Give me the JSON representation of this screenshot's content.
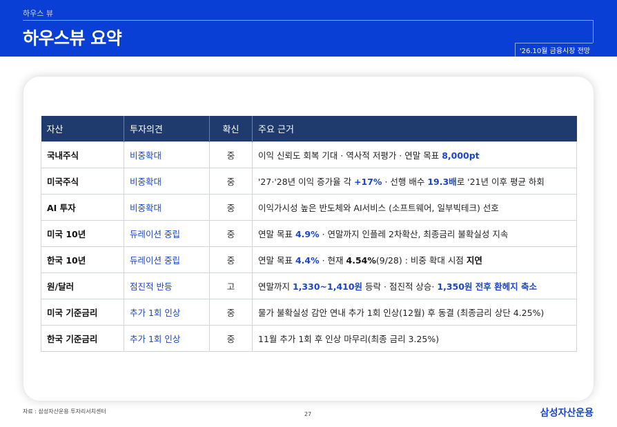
{
  "header": {
    "kicker": "하우스 뷰",
    "title": "하우스뷰 요약",
    "tag": "'26.10월 금융시장 전망"
  },
  "table": {
    "columns": [
      "자산",
      "투자의견",
      "확신",
      "주요 근거"
    ],
    "rows": [
      {
        "asset": "국내주식",
        "opinion": "비중확대",
        "confidence": "중",
        "rationale": [
          {
            "t": "이익 신뢰도 회복 기대 · 역사적 저평가 · 연말 목표 ",
            "s": "n"
          },
          {
            "t": "8,000pt",
            "s": "hl"
          }
        ]
      },
      {
        "asset": "미국주식",
        "opinion": "비중확대",
        "confidence": "중",
        "rationale": [
          {
            "t": "'27·'28년 이익 증가율 각 ",
            "s": "n"
          },
          {
            "t": "+17%",
            "s": "hl"
          },
          {
            "t": " · 선행 배수 ",
            "s": "n"
          },
          {
            "t": "19.3배",
            "s": "hl"
          },
          {
            "t": "로 '21년 이후 평균 하회",
            "s": "n"
          }
        ]
      },
      {
        "asset": "AI 투자",
        "opinion": "비중확대",
        "confidence": "중",
        "rationale": [
          {
            "t": "이익가시성 높은 반도체와 AI서비스 (소프트웨어, 일부빅테크) 선호",
            "s": "n"
          }
        ]
      },
      {
        "asset": "미국 10년",
        "opinion": "듀레이션 중립",
        "confidence": "중",
        "rationale": [
          {
            "t": "연말 목표 ",
            "s": "n"
          },
          {
            "t": "4.9%",
            "s": "hl"
          },
          {
            "t": " · 연말까지 인플레 2차확산, 최종금리 불확실성 지속",
            "s": "n"
          }
        ]
      },
      {
        "asset": "한국 10년",
        "opinion": "듀레이션 중립",
        "confidence": "중",
        "rationale": [
          {
            "t": "연말 목표 ",
            "s": "n"
          },
          {
            "t": "4.4%",
            "s": "hl"
          },
          {
            "t": " · 현재 ",
            "s": "n"
          },
          {
            "t": "4.54%",
            "s": "bk"
          },
          {
            "t": "(9/28) : 비중 확대 시점 ",
            "s": "n"
          },
          {
            "t": "지연",
            "s": "bk"
          }
        ]
      },
      {
        "asset": "원/달러",
        "opinion": "점진적 반등",
        "confidence": "고",
        "rationale": [
          {
            "t": "연말까지 ",
            "s": "n"
          },
          {
            "t": "1,330~1,410원",
            "s": "hl"
          },
          {
            "t": " 등락 · 점진적 상승· ",
            "s": "n"
          },
          {
            "t": "1,350원 전후 환헤지 축소",
            "s": "hl"
          }
        ]
      },
      {
        "asset": "미국 기준금리",
        "opinion": "추가 1회 인상",
        "confidence": "중",
        "rationale": [
          {
            "t": "물가 불확실성 감안 연내 추가 1회 인상(12월) 후 동결 (최종금리 상단 4.25%)",
            "s": "n"
          }
        ]
      },
      {
        "asset": "한국 기준금리",
        "opinion": "추가 1회 인상",
        "confidence": "중",
        "rationale": [
          {
            "t": "11월 추가 1회 후 인상 마무리(최종 금리 3.25%)",
            "s": "n"
          }
        ]
      }
    ]
  },
  "footer": {
    "source": "자료 : 삼성자산운용 투자리서치센터",
    "page": "27",
    "brand": "삼성자산운용"
  },
  "colors": {
    "header_bg": "#0a3fd6",
    "table_header_bg": "#1f3a6d",
    "highlight": "#1b47c5"
  }
}
